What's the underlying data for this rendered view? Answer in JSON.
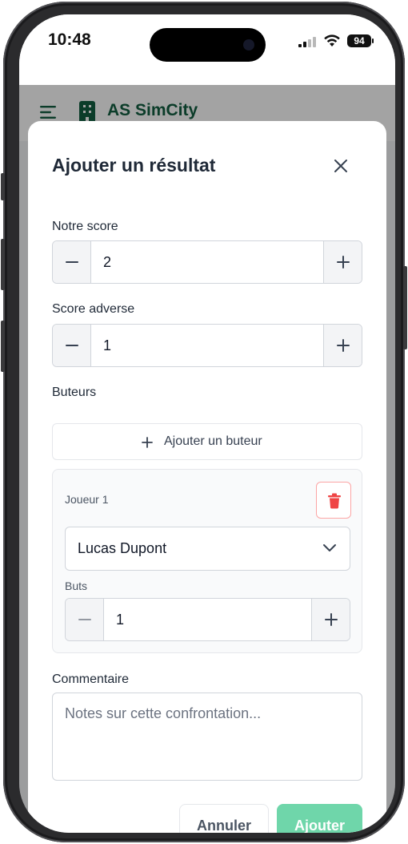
{
  "status_bar": {
    "time": "10:48",
    "battery": "94"
  },
  "app": {
    "title": "AS SimCity"
  },
  "modal": {
    "title": "Ajouter un résultat",
    "our_score": {
      "label": "Notre score",
      "value": "2"
    },
    "opponent_score": {
      "label": "Score adverse",
      "value": "1"
    },
    "scorers": {
      "label": "Buteurs",
      "add_label": "Ajouter un buteur",
      "items": [
        {
          "title": "Joueur 1",
          "player": "Lucas Dupont",
          "goals_label": "Buts",
          "goals": "1"
        }
      ]
    },
    "comment": {
      "label": "Commentaire",
      "placeholder": "Notes sur cette confrontation..."
    },
    "cancel_label": "Annuler",
    "submit_label": "Ajouter"
  },
  "colors": {
    "brand": "#125e40",
    "submit": "#6fd6aa",
    "danger": "#ef4444"
  },
  "icons": [
    "menu-icon",
    "building-icon",
    "close-icon",
    "minus-icon",
    "plus-icon",
    "trash-icon",
    "chevron-down-icon"
  ]
}
